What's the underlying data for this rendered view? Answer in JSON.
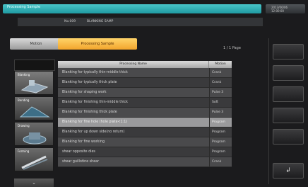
{
  "titlebar": {
    "title": "Processing Sample"
  },
  "clock": {
    "line1": "2013/06/06",
    "line2": "12:00:00"
  },
  "program": {
    "number": "No.009",
    "name": "BLANKING SAMP"
  },
  "tabs": {
    "motion": "Motion",
    "processing": "Processing Sample"
  },
  "page_indicator": "1 / 1  Page",
  "categories": [
    {
      "label": "Blanking"
    },
    {
      "label": "Bending"
    },
    {
      "label": "Drawing"
    },
    {
      "label": "Forming"
    }
  ],
  "table": {
    "headers": {
      "name": "Processing Name",
      "motion": "Motion"
    },
    "rows": [
      {
        "name": "Blanking for typically thin-middle thick",
        "motion": "Crank"
      },
      {
        "name": "Blanking for typically thick plate",
        "motion": "Crank"
      },
      {
        "name": "Blanking for shaping work",
        "motion": "Pulse 3"
      },
      {
        "name": "Blanking for finishing thin-middle thick",
        "motion": "Soft"
      },
      {
        "name": "Blanking for finishing thick plate",
        "motion": "Pulse 3"
      },
      {
        "name": "Blanking for fine hole (hole plate<1:1)",
        "motion": "Program"
      },
      {
        "name": "Blanking for up down side(no return)",
        "motion": "Program"
      },
      {
        "name": "Blanking for fine working",
        "motion": "Program"
      },
      {
        "name": "shear opposite dies",
        "motion": "Program"
      },
      {
        "name": "shear guillotine shear",
        "motion": "Crank"
      }
    ]
  },
  "nav": {
    "down_arrow": "⌄",
    "enter_symbol": "↲"
  },
  "icons": {
    "down": "chevron-down-icon",
    "enter": "enter-icon"
  }
}
